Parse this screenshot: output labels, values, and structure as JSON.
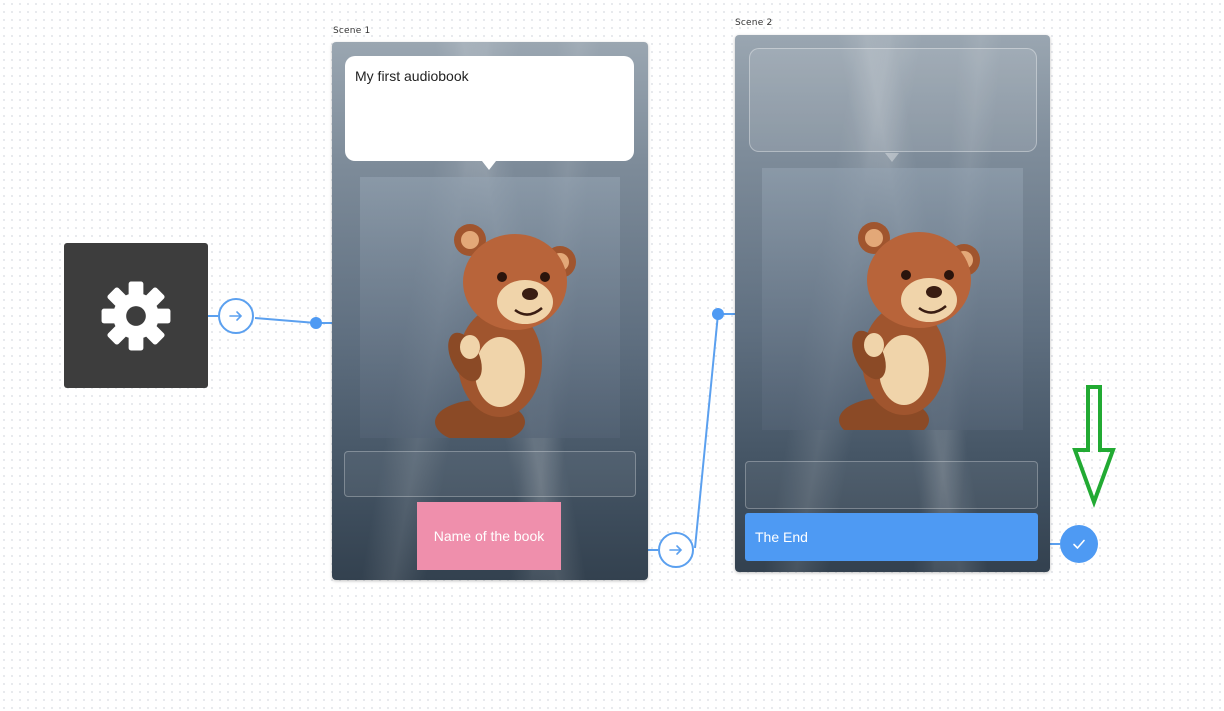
{
  "canvas": {
    "settings_node": {
      "icon": "gear-icon"
    },
    "start_port": {
      "icon": "arrow-right-icon"
    }
  },
  "scenes": [
    {
      "label": "Scene 1",
      "speech_text": "My first audiobook",
      "image": "teddy-bear",
      "text_slot": "",
      "button_label": "Name of the book",
      "button_color": "#ef8fac"
    },
    {
      "label": "Scene 2",
      "speech_text": "",
      "image": "teddy-bear",
      "text_slot": "",
      "button_label": "The End",
      "button_color": "#4e9af3",
      "end_icon": "checkmark-icon"
    }
  ],
  "annotation": {
    "icon": "green-down-arrow-icon",
    "color": "#22aa33"
  },
  "colors": {
    "connector": "#5ba0ef",
    "settings_bg": "#3d3d3d"
  }
}
